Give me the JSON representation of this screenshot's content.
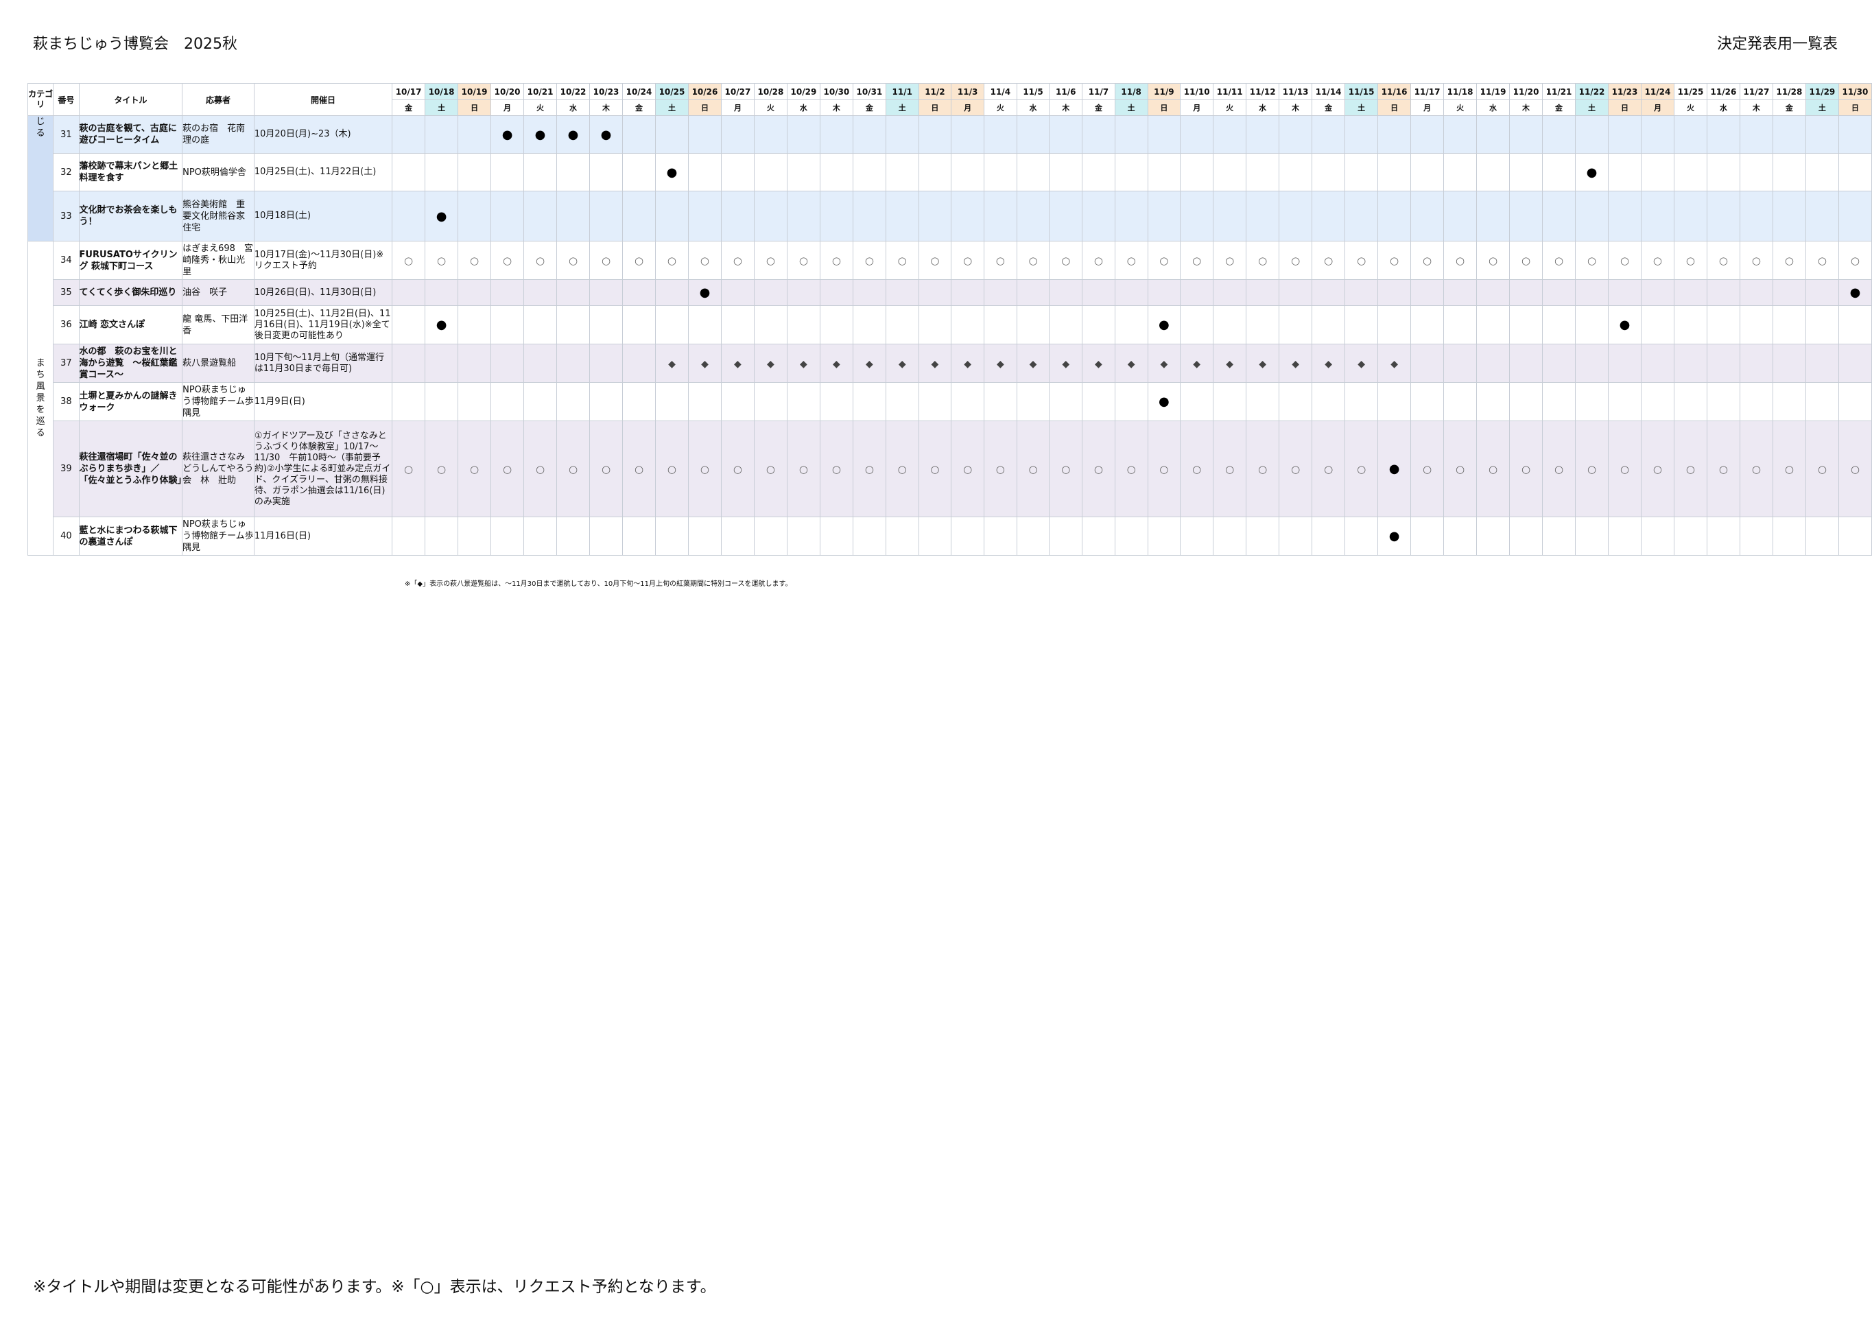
{
  "header": {
    "title": "萩まちじゅう博覧会　2025秋",
    "subtitle": "決定発表用一覧表"
  },
  "table": {
    "columns": {
      "category": "カテゴリ",
      "number": "番号",
      "title": "タイトル",
      "organizer": "応募者",
      "period": "開催日"
    },
    "dates": [
      {
        "d": "10/17",
        "w": "金"
      },
      {
        "d": "10/18",
        "w": "土"
      },
      {
        "d": "10/19",
        "w": "日"
      },
      {
        "d": "10/20",
        "w": "月"
      },
      {
        "d": "10/21",
        "w": "火"
      },
      {
        "d": "10/22",
        "w": "水"
      },
      {
        "d": "10/23",
        "w": "木"
      },
      {
        "d": "10/24",
        "w": "金"
      },
      {
        "d": "10/25",
        "w": "土"
      },
      {
        "d": "10/26",
        "w": "日"
      },
      {
        "d": "10/27",
        "w": "月"
      },
      {
        "d": "10/28",
        "w": "火"
      },
      {
        "d": "10/29",
        "w": "水"
      },
      {
        "d": "10/30",
        "w": "木"
      },
      {
        "d": "10/31",
        "w": "金"
      },
      {
        "d": "11/1",
        "w": "土"
      },
      {
        "d": "11/2",
        "w": "日"
      },
      {
        "d": "11/3",
        "w": "月"
      },
      {
        "d": "11/4",
        "w": "火"
      },
      {
        "d": "11/5",
        "w": "水"
      },
      {
        "d": "11/6",
        "w": "木"
      },
      {
        "d": "11/7",
        "w": "金"
      },
      {
        "d": "11/8",
        "w": "土"
      },
      {
        "d": "11/9",
        "w": "日"
      },
      {
        "d": "11/10",
        "w": "月"
      },
      {
        "d": "11/11",
        "w": "火"
      },
      {
        "d": "11/12",
        "w": "水"
      },
      {
        "d": "11/13",
        "w": "木"
      },
      {
        "d": "11/14",
        "w": "金"
      },
      {
        "d": "11/15",
        "w": "土"
      },
      {
        "d": "11/16",
        "w": "日"
      },
      {
        "d": "11/17",
        "w": "月"
      },
      {
        "d": "11/18",
        "w": "火"
      },
      {
        "d": "11/19",
        "w": "水"
      },
      {
        "d": "11/20",
        "w": "木"
      },
      {
        "d": "11/21",
        "w": "金"
      },
      {
        "d": "11/22",
        "w": "土"
      },
      {
        "d": "11/23",
        "w": "日"
      },
      {
        "d": "11/24",
        "w": "月"
      },
      {
        "d": "11/25",
        "w": "火"
      },
      {
        "d": "11/26",
        "w": "水"
      },
      {
        "d": "11/27",
        "w": "木"
      },
      {
        "d": "11/28",
        "w": "金"
      },
      {
        "d": "11/29",
        "w": "土"
      },
      {
        "d": "11/30",
        "w": "日"
      }
    ],
    "holidays": [
      "11/3",
      "11/24"
    ],
    "categories": [
      {
        "label": "じる",
        "row_count": 3,
        "style": "blue"
      },
      {
        "label": "まち風景を巡る",
        "row_count": 7,
        "style": "purple"
      }
    ],
    "rows": [
      {
        "num": "31",
        "title": "萩の古庭を観て、古庭に遊びコーヒータイム",
        "organizer": "萩のお宿　花南理の庭",
        "period": "10月20日(月)~23（木)",
        "style": "blue",
        "marks": {
          "10/20": "●",
          "10/21": "●",
          "10/22": "●",
          "10/23": "●"
        }
      },
      {
        "num": "32",
        "title": "藩校跡で幕末パンと郷土料理を食す",
        "organizer": "NPO萩明倫学舎",
        "period": "10月25日(土)、11月22日(土)",
        "style": "white",
        "marks": {
          "10/25": "●",
          "11/22": "●"
        }
      },
      {
        "num": "33",
        "title": "文化財でお茶会を楽しもう！",
        "organizer": "熊谷美術館　重要文化財熊谷家住宅",
        "period": "10月18日(土)",
        "style": "blue",
        "marks": {
          "10/18": "●"
        }
      },
      {
        "num": "34",
        "title": "FURUSATOサイクリング 萩城下町コース",
        "organizer": "はぎまえ698　宮崎隆秀・秋山光里",
        "period": "10月17日(金)〜11月30日(日)※リクエスト予約",
        "style": "white",
        "fill": "○",
        "marks": {}
      },
      {
        "num": "35",
        "title": "てくてく歩く御朱印巡り",
        "organizer": "油谷　咲子",
        "period": "10月26日(日)、11月30日(日)",
        "style": "purple",
        "marks": {
          "10/26": "●",
          "11/30": "●"
        }
      },
      {
        "num": "36",
        "title": "江崎 恋文さんぽ",
        "organizer": "龍 竜馬、下田洋香",
        "period": "10月25日(土)、11月2日(日)、11月16日(日)、11月19日(水)※全て後日変更の可能性あり",
        "style": "white",
        "marks": {
          "10/18": "●",
          "11/9": "●",
          "11/23": "●"
        }
      },
      {
        "num": "37",
        "title": "水の都　萩のお宝を川と海から遊覧　〜桜紅葉鑑賞コース〜",
        "organizer": "萩八景遊覧船",
        "period": "10月下旬〜11月上旬（通常運行は11月30日まで毎日可)",
        "style": "purple",
        "diamond_range": [
          "10/25",
          "11/16"
        ],
        "marks": {}
      },
      {
        "num": "38",
        "title": "土塀と夏みかんの謎解きウォーク",
        "organizer": "NPO萩まちじゅう博物館チーム歩隅見",
        "period": "11月9日(日)",
        "style": "white",
        "marks": {
          "11/9": "●"
        }
      },
      {
        "num": "39",
        "title": "萩往還宿場町「佐々並のぶらりまち歩き」／「佐々並とうふ作り体験」",
        "organizer": "萩往還ささなみどうしんてやろう会　林　壯助",
        "period": "①ガイドツアー及び「ささなみとうふづくり体験教室」10/17〜11/30　午前10時〜（事前要予約)②小学生による町並み定点ガイド、クイズラリー、甘粥の無料接待、ガラポン抽選会は11/16(日)のみ実施",
        "style": "purple",
        "fill": "○",
        "marks": {
          "11/16": "●"
        }
      },
      {
        "num": "40",
        "title": "藍と水にまつわる萩城下の裏道さんぽ",
        "organizer": "NPO萩まちじゅう博物館チーム歩隅見",
        "period": "11月16日(日)",
        "style": "white",
        "marks": {
          "11/16": "●"
        }
      }
    ]
  },
  "notes": {
    "diamond_note": "※「◆」表示の萩八景遊覧船は、〜11月30日まで運航しており、10月下旬〜11月上旬の紅葉期間に特別コースを運航します。",
    "bottom_note": "※タイトルや期間は変更となる可能性があります。※「○」表示は、リクエスト予約となります。"
  },
  "colors": {
    "saturday": "#cdeff2",
    "sunday": "#fbe6cf",
    "row_blue": "#e3eefb",
    "row_purple": "#ede9f3",
    "category_blue": "#cfdff5",
    "category_purple": "#e4dff0"
  }
}
